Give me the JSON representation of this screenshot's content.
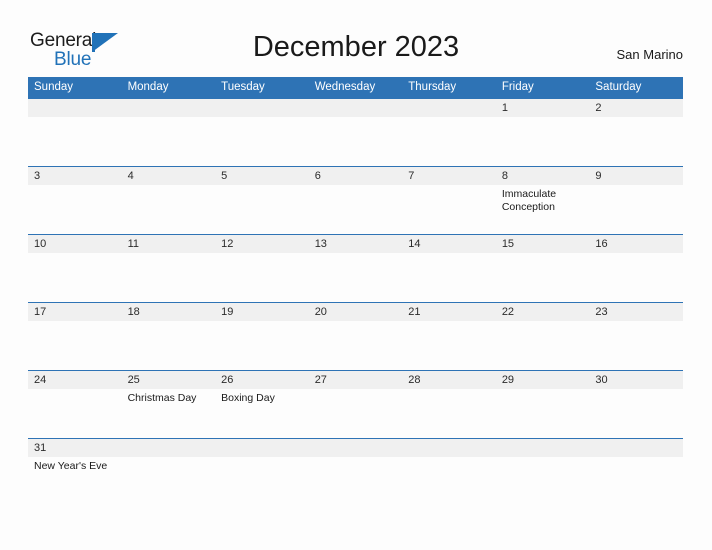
{
  "brand": {
    "name_part1": "General",
    "name_part2": "Blue",
    "flag_icon": "blue-triangle-flag-icon",
    "accent_color": "#2172b8"
  },
  "header": {
    "title": "December 2023",
    "region": "San Marino"
  },
  "colors": {
    "header_band": "#2e73b5",
    "date_band": "#f0f0f0",
    "row_divider": "#2e73b5",
    "page_background": "#fdfdfd",
    "text": "#1a1a1a"
  },
  "calendar": {
    "month": "December",
    "year": "2023",
    "day_headers": [
      "Sunday",
      "Monday",
      "Tuesday",
      "Wednesday",
      "Thursday",
      "Friday",
      "Saturday"
    ],
    "weeks": [
      {
        "days": [
          {
            "date": "",
            "event": ""
          },
          {
            "date": "",
            "event": ""
          },
          {
            "date": "",
            "event": ""
          },
          {
            "date": "",
            "event": ""
          },
          {
            "date": "",
            "event": ""
          },
          {
            "date": "1",
            "event": ""
          },
          {
            "date": "2",
            "event": ""
          }
        ]
      },
      {
        "days": [
          {
            "date": "3",
            "event": ""
          },
          {
            "date": "4",
            "event": ""
          },
          {
            "date": "5",
            "event": ""
          },
          {
            "date": "6",
            "event": ""
          },
          {
            "date": "7",
            "event": ""
          },
          {
            "date": "8",
            "event": "Immaculate Conception"
          },
          {
            "date": "9",
            "event": ""
          }
        ]
      },
      {
        "days": [
          {
            "date": "10",
            "event": ""
          },
          {
            "date": "11",
            "event": ""
          },
          {
            "date": "12",
            "event": ""
          },
          {
            "date": "13",
            "event": ""
          },
          {
            "date": "14",
            "event": ""
          },
          {
            "date": "15",
            "event": ""
          },
          {
            "date": "16",
            "event": ""
          }
        ]
      },
      {
        "days": [
          {
            "date": "17",
            "event": ""
          },
          {
            "date": "18",
            "event": ""
          },
          {
            "date": "19",
            "event": ""
          },
          {
            "date": "20",
            "event": ""
          },
          {
            "date": "21",
            "event": ""
          },
          {
            "date": "22",
            "event": ""
          },
          {
            "date": "23",
            "event": ""
          }
        ]
      },
      {
        "days": [
          {
            "date": "24",
            "event": ""
          },
          {
            "date": "25",
            "event": "Christmas Day"
          },
          {
            "date": "26",
            "event": "Boxing Day"
          },
          {
            "date": "27",
            "event": ""
          },
          {
            "date": "28",
            "event": ""
          },
          {
            "date": "29",
            "event": ""
          },
          {
            "date": "30",
            "event": ""
          }
        ]
      },
      {
        "days": [
          {
            "date": "31",
            "event": "New Year's Eve"
          },
          {
            "date": "",
            "event": ""
          },
          {
            "date": "",
            "event": ""
          },
          {
            "date": "",
            "event": ""
          },
          {
            "date": "",
            "event": ""
          },
          {
            "date": "",
            "event": ""
          },
          {
            "date": "",
            "event": ""
          }
        ]
      }
    ]
  }
}
